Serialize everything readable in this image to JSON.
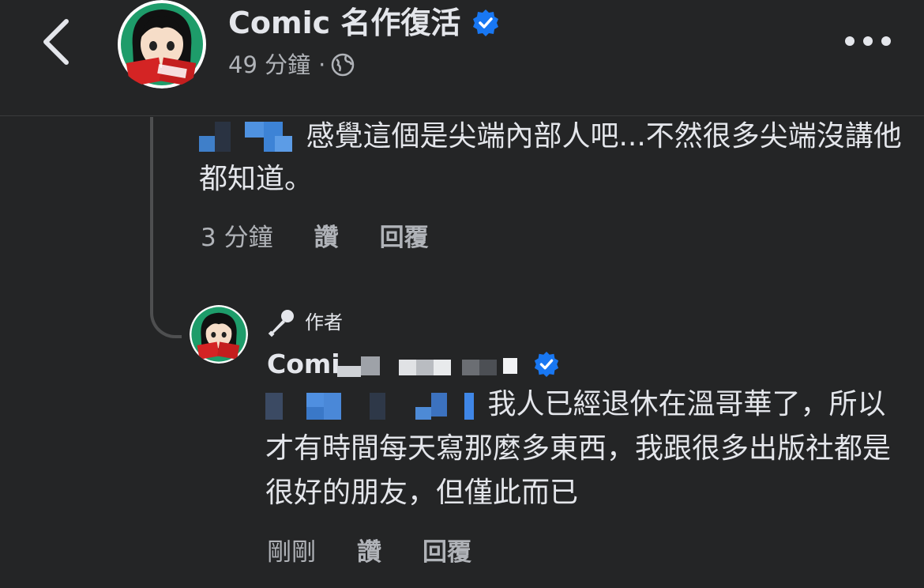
{
  "header": {
    "page_name": "Comic 名作復活",
    "time": "49 分鐘",
    "separator": "·",
    "icons": {
      "back": "chevron-left-icon",
      "verified": "verified-badge-icon",
      "audience": "globe-icon",
      "more": "more-options-icon"
    }
  },
  "comment1": {
    "text": "感覺這個是尖端內部人吧...不然很多尖端沒講他都知道。",
    "time": "3 分鐘",
    "like_label": "讚",
    "reply_label": "回覆"
  },
  "comment2": {
    "badge_label": "作者",
    "author_visible_text": "Comi",
    "text": "我人已經退休在溫哥華了，所以才有時間每天寫那麼多東西，我跟很多出版社都是很好的朋友，但僅此而已",
    "time": "剛剛",
    "like_label": "讚",
    "reply_label": "回覆"
  },
  "colors": {
    "background": "#242526",
    "text_primary": "#e4e6eb",
    "text_secondary": "#b0b3b8",
    "verified_blue": "#1877f2"
  }
}
